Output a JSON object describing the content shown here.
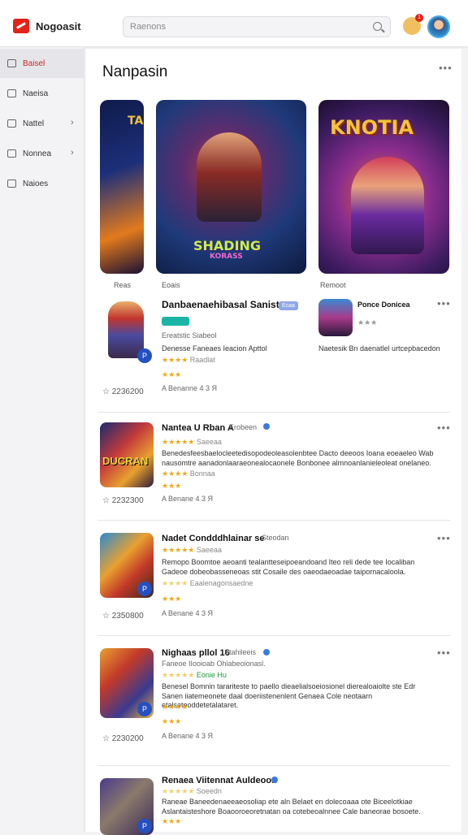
{
  "header": {
    "brand": "Nogoasit",
    "search_placeholder": "Raenons",
    "notification_count": "1"
  },
  "sidebar": {
    "items": [
      {
        "label": "Baisel",
        "chevron": ""
      },
      {
        "label": "Naeisa",
        "chevron": ""
      },
      {
        "label": "Nattel",
        "chevron": "›"
      },
      {
        "label": "Nonnea",
        "chevron": "›"
      },
      {
        "label": "Naioes",
        "chevron": ""
      }
    ]
  },
  "main": {
    "title": "Nanpasin",
    "more": "•••",
    "featured": [
      {
        "caption": "Reas",
        "art_title": "TAI"
      },
      {
        "caption": "Eoais",
        "art_title": "SHADING",
        "art_subtitle": "KORASS"
      },
      {
        "caption": "Remoot",
        "art_title": "KNOTIA"
      }
    ],
    "side_card": {
      "title": "Ponce Donicea",
      "desc": "Naetesik Bn daenatlel urtcepbacedon"
    },
    "items": [
      {
        "title": "Danbaenaehibasal Sanista",
        "badge": "Ecaa",
        "publisher": "Ereatstic Siabeol",
        "desc": "Denesse Faneaes Ieacion Apttol",
        "rating_text": "Raadlat",
        "count": "2236200",
        "installs": "A Benanne 4 3 Я"
      },
      {
        "title": "Nantea U Rban A",
        "badge": "Erobeen",
        "publisher": "Saeeaa",
        "desc": "Benedesfeesbaelocleetedisopodeoleasolenbtee Dacto deeoos Ioana eoeaeleo Wab nausomtre aanadonlaaraeonealocaonele Bonbonee almnoanlanieleoleat onelaneo.",
        "rating_text": "Bonnaa",
        "count": "2232300",
        "installs": "A Benane 4 3 Я"
      },
      {
        "title": "Nadet Condddhlainar se",
        "badge": "Steodan",
        "publisher": "Saeeaa",
        "desc": "Remopo Boomtoe aeoanti tealantteseipoeandoand Iteo reli dede tee Iocaliban Gadeoe dobeobasseneoas stit Cosaile des oaeodaeoadae taipornacaloola.",
        "rating_text": "Eaalenagonsaedne",
        "count": "2350800",
        "installs": "A Benane 4 3 Я"
      },
      {
        "title": "Nighaas pllol 16",
        "badge": "Stahileeis",
        "publisher": "Faneoe IIooioab Ohiabeoionasl.",
        "desc": "Benesel Bomnin tarariteste to paello dieaelialsoeiosionel dierealoaiolte ste Edr Sanen iiatemeonete daal doeriistenenlent Genaea Cole neotaarn etalseteoddetetalataret.",
        "rating_text": "Eonie Hu",
        "count": "2230200",
        "installs": "A Benane 4 3 Я"
      },
      {
        "title": "Renaea Viitennat Auldeoon",
        "badge": "",
        "publisher": "Soeedn",
        "desc": "Raneae Baneedenaeeaeosoliap ete aln Belaet en dolecoaaa ote Biceelotkiae Aslantaisteshore Boaooroeoretnatan oa cotebeoalnnee Cale baneorae bosoete.",
        "rating_text": "",
        "count": "",
        "installs": ""
      }
    ]
  }
}
